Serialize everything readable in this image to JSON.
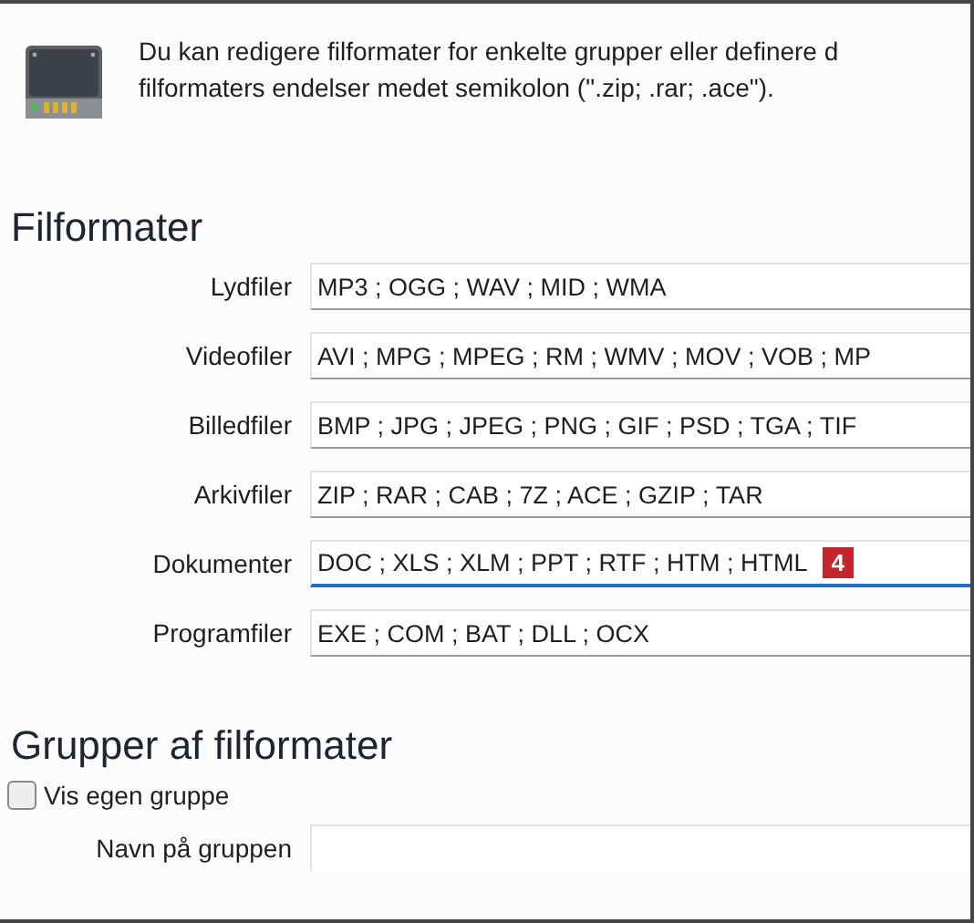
{
  "intro": {
    "text": "Du kan redigere filformater for enkelte grupper eller definere d",
    "text_2": "filformaters endelser medet semikolon (\".zip; .rar; .ace\")."
  },
  "formats": {
    "heading": "Filformater",
    "rows": [
      {
        "label": "Lydfiler",
        "value": "MP3 ; OGG ; WAV ; MID ; WMA",
        "focused": false
      },
      {
        "label": "Videofiler",
        "value": "AVI ; MPG ; MPEG ; RM ; WMV ; MOV ; VOB ; MP",
        "focused": false
      },
      {
        "label": "Billedfiler",
        "value": "BMP ; JPG ; JPEG ; PNG ; GIF ; PSD ; TGA ; TIF",
        "focused": false
      },
      {
        "label": "Arkivfiler",
        "value": "ZIP ; RAR ; CAB ; 7Z ; ACE ; GZIP ; TAR",
        "focused": false
      },
      {
        "label": "Dokumenter",
        "value": "DOC ; XLS ; XLM ; PPT ; RTF ; HTM ; HTML",
        "focused": true,
        "badge": "4"
      },
      {
        "label": "Programfiler",
        "value": "EXE ; COM ; BAT ; DLL ; OCX",
        "focused": false
      }
    ]
  },
  "groups": {
    "heading": "Grupper af filformater",
    "checkbox": {
      "label": "Vis egen gruppe",
      "checked": false
    },
    "name_field": {
      "label": "Navn på gruppen"
    }
  }
}
